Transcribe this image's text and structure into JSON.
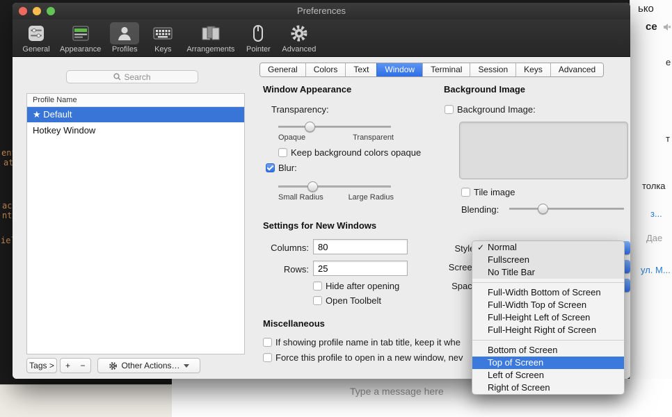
{
  "chrome": {
    "title": "Preferences"
  },
  "toolbar": {
    "items": [
      {
        "label": "General"
      },
      {
        "label": "Appearance"
      },
      {
        "label": "Profiles"
      },
      {
        "label": "Keys"
      },
      {
        "label": "Arrangements"
      },
      {
        "label": "Pointer"
      },
      {
        "label": "Advanced"
      }
    ],
    "selected": "Profiles"
  },
  "sidebar": {
    "search_placeholder": "Search",
    "header": "Profile Name",
    "rows": [
      {
        "label": "★ Default",
        "selected": true
      },
      {
        "label": "Hotkey Window",
        "selected": false
      }
    ],
    "tags_button": "Tags >",
    "add_button": "+",
    "remove_button": "−",
    "other_actions_button": "Other Actions…"
  },
  "tabs": {
    "items": [
      {
        "label": "General"
      },
      {
        "label": "Colors"
      },
      {
        "label": "Text"
      },
      {
        "label": "Window"
      },
      {
        "label": "Terminal"
      },
      {
        "label": "Session"
      },
      {
        "label": "Keys"
      },
      {
        "label": "Advanced"
      }
    ],
    "active": "Window"
  },
  "window_appearance": {
    "heading": "Window Appearance",
    "transparency_label": "Transparency:",
    "opaque_label": "Opaque",
    "transparent_label": "Transparent",
    "transparency_value_pct": 28,
    "keep_opaque_label": "Keep background colors opaque",
    "keep_opaque_checked": false,
    "blur_label": "Blur:",
    "blur_checked": true,
    "small_radius_label": "Small Radius",
    "large_radius_label": "Large Radius",
    "blur_value_pct": 30
  },
  "new_windows": {
    "heading": "Settings for New Windows",
    "columns_label": "Columns:",
    "columns_value": "80",
    "rows_label": "Rows:",
    "rows_value": "25",
    "hide_after_opening_label": "Hide after opening",
    "open_toolbelt_label": "Open Toolbelt",
    "style_label": "Style:",
    "screen_label": "Screen",
    "space_label": "Space"
  },
  "miscellaneous": {
    "heading": "Miscellaneous",
    "profile_name_option": "If showing profile name in tab title, keep it whe",
    "force_window_option": "Force this profile to open in a new window, nev"
  },
  "background_image": {
    "heading": "Background Image",
    "checkbox_label": "Background Image:",
    "tile_image_label": "Tile image",
    "blending_label": "Blending:",
    "blending_value_pct": 29
  },
  "style_menu": {
    "check_glyph": "✓",
    "group1": [
      {
        "label": "Normal"
      },
      {
        "label": "Fullscreen"
      },
      {
        "label": "No Title Bar"
      }
    ],
    "group2": [
      {
        "label": "Full-Width Bottom of Screen"
      },
      {
        "label": "Full-Width Top of Screen"
      },
      {
        "label": "Full-Height Left of Screen"
      },
      {
        "label": "Full-Height Right of Screen"
      }
    ],
    "group3": [
      {
        "label": "Bottom of Screen"
      },
      {
        "label": "Top of Screen"
      },
      {
        "label": "Left of Screen"
      },
      {
        "label": "Right of Screen"
      }
    ],
    "checked_item": "Normal",
    "highlighted_item": "Top of Screen"
  },
  "desktop": {
    "code_fragments": [
      {
        "text": "ent-"
      },
      {
        "text": "ate"
      },
      {
        "text": "aci"
      },
      {
        "text": "nt;"
      },
      {
        "text": "ield-"
      }
    ],
    "chat_fragments": {
      "f1": "ько",
      "f2": "ce",
      "f3": "е",
      "f4": "т",
      "f5": "толка",
      "f6": "з...",
      "f7": "Дае",
      "f8": "ул. М..."
    },
    "message_placeholder": "Type a message here"
  },
  "colors": {
    "accent_blue": "#3875d7",
    "menu_highlight": "#3c79dd",
    "tab_selected": "#2e6ee5"
  }
}
